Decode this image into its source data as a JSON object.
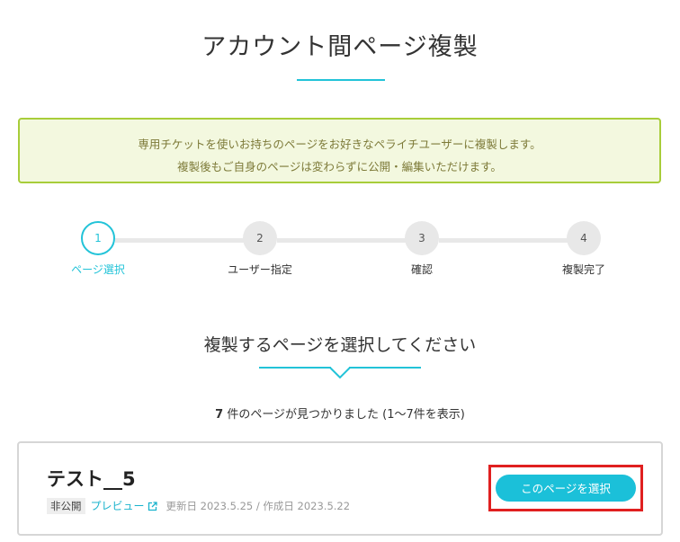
{
  "header": {
    "title": "アカウント間ページ複製",
    "accent_color": "#22c3d8"
  },
  "notice": {
    "line1": "専用チケットを使いお持ちのページをお好きなペライチユーザーに複製します。",
    "line2": "複製後もご自身のページは変わらずに公開・編集いただけます。",
    "border_color": "#a8cd3a",
    "background_color": "#f3f8df"
  },
  "steps": [
    {
      "number": "1",
      "label": "ページ選択",
      "active": true
    },
    {
      "number": "2",
      "label": "ユーザー指定",
      "active": false
    },
    {
      "number": "3",
      "label": "確認",
      "active": false
    },
    {
      "number": "4",
      "label": "複製完了",
      "active": false
    }
  ],
  "section": {
    "title": "複製するページを選択してください"
  },
  "result": {
    "count": "7",
    "text": "件のページが見つかりました (1〜7件を表示)"
  },
  "page_card": {
    "title": "テスト__5",
    "status_badge": "非公開",
    "preview_label": "プレビュー",
    "preview_icon": "external-link-icon",
    "dates": "更新日 2023.5.25 / 作成日 2023.5.22",
    "select_button_label": "このページを選択",
    "highlight_color": "#e02020"
  }
}
